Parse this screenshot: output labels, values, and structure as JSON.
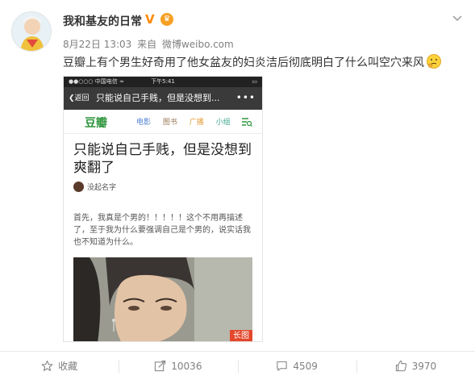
{
  "user": {
    "name": "我和基友的日常",
    "verified_badge": "V",
    "member_badge": "♛"
  },
  "meta": {
    "date": "8月22日 13:03",
    "source_prefix": "来自",
    "source": "微博weibo.com"
  },
  "post": {
    "text": "豆瓣上有个男生好奇用了他女盆友的妇炎洁后彻底明白了什么叫空穴来风"
  },
  "embedded": {
    "status": {
      "carrier": "●●○○○ 中国电信 ≈",
      "time": "下午5:41",
      "battery": "▭"
    },
    "nav": {
      "back": "❮返回",
      "title": "只能说自己手贱，但是没想到...",
      "more": "•••"
    },
    "site": {
      "logo": "豆瓣",
      "nav": [
        "电影",
        "图书",
        "广播",
        "小组"
      ]
    },
    "article": {
      "title": "只能说自己手贱，但是没想到爽翻了",
      "author": "没起名字",
      "body": "首先，我真是个男的！！！！！这个不用再描述了，至于我为什么要强调自己是个男的，说实话我也不知道为什么。"
    },
    "long_image_label": "长图"
  },
  "actions": {
    "favorite": "收藏",
    "repost": "10036",
    "comment": "4509",
    "like": "3970"
  },
  "colors": {
    "douban_green": "#2e963d",
    "long_image": "#e4472b",
    "verified": "#ff8a00"
  }
}
